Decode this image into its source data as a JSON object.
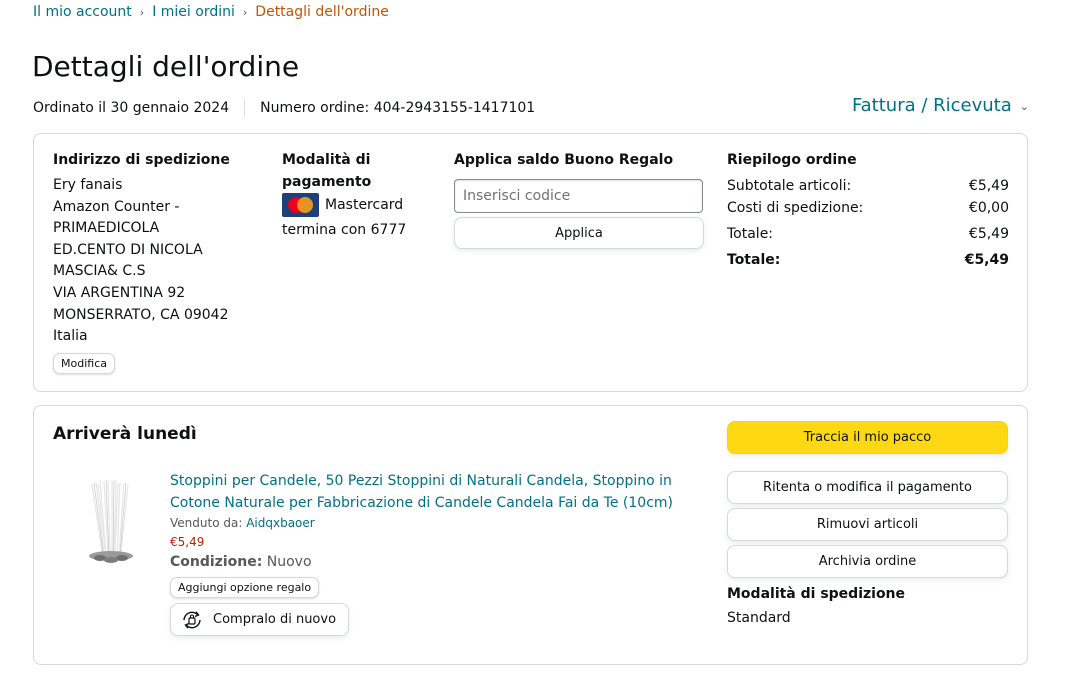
{
  "breadcrumb": {
    "account": "Il mio account",
    "orders": "I miei ordini",
    "current": "Dettagli dell'ordine",
    "sep": "›"
  },
  "page_title": "Dettagli dell'ordine",
  "order": {
    "ordered_on": "Ordinato il 30 gennaio 2024",
    "order_number": "Numero ordine: 404-2943155-1417101"
  },
  "invoice_label": "Fattura / Ricevuta",
  "shipping_address": {
    "heading": "Indirizzo di spedizione",
    "lines": [
      "Ery fanais",
      "Amazon Counter -",
      "PRIMAEDICOLA",
      "ED.CENTO DI NICOLA",
      "MASCIA& C.S",
      "VIA ARGENTINA 92",
      "MONSERRATO, CA 09042",
      "Italia"
    ],
    "modify_label": "Modifica"
  },
  "payment": {
    "heading_line1": "Modalità di",
    "heading_line2": "pagamento",
    "card_brand": "Mastercard",
    "card_ending": "termina con 6777",
    "icon": "mastercard-icon"
  },
  "gift_card": {
    "heading": "Applica saldo Buono Regalo",
    "placeholder": "Inserisci codice",
    "apply_label": "Applica"
  },
  "summary": {
    "heading": "Riepilogo ordine",
    "rows": [
      {
        "label": "Subtotale articoli:",
        "value": "€5,49"
      },
      {
        "label": "Costi di spedizione:",
        "value": "€0,00"
      },
      {
        "label": "Totale:",
        "value": "€5,49"
      },
      {
        "label": "Totale:",
        "value": "€5,49"
      }
    ]
  },
  "shipment": {
    "arrival": "Arriverà lunedì",
    "product": {
      "title": "Stoppini per Candele, 50 Pezzi Stoppini di Naturali Candela, Stoppino in Cotone Naturale per Fabbricazione di Candele Candela Fai da Te (10cm)",
      "sold_by_label": "Venduto da:",
      "seller": "Aidqxbaoer",
      "price": "€5,49",
      "condition_label": "Condizione:",
      "condition": "Nuovo",
      "gift_option_label": "Aggiungi opzione regalo",
      "buy_again_label": "Compralo di nuovo"
    },
    "actions": {
      "track": "Traccia il mio pacco",
      "retry_payment": "Ritenta o modifica il pagamento",
      "remove": "Rimuovi articoli",
      "archive": "Archivia ordine"
    },
    "shipping_method_heading": "Modalità di spedizione",
    "shipping_method": "Standard"
  },
  "colors": {
    "link": "#007185",
    "breadcrumb_current": "#c45500",
    "price": "#b12704",
    "primary_button": "#ffd814"
  }
}
